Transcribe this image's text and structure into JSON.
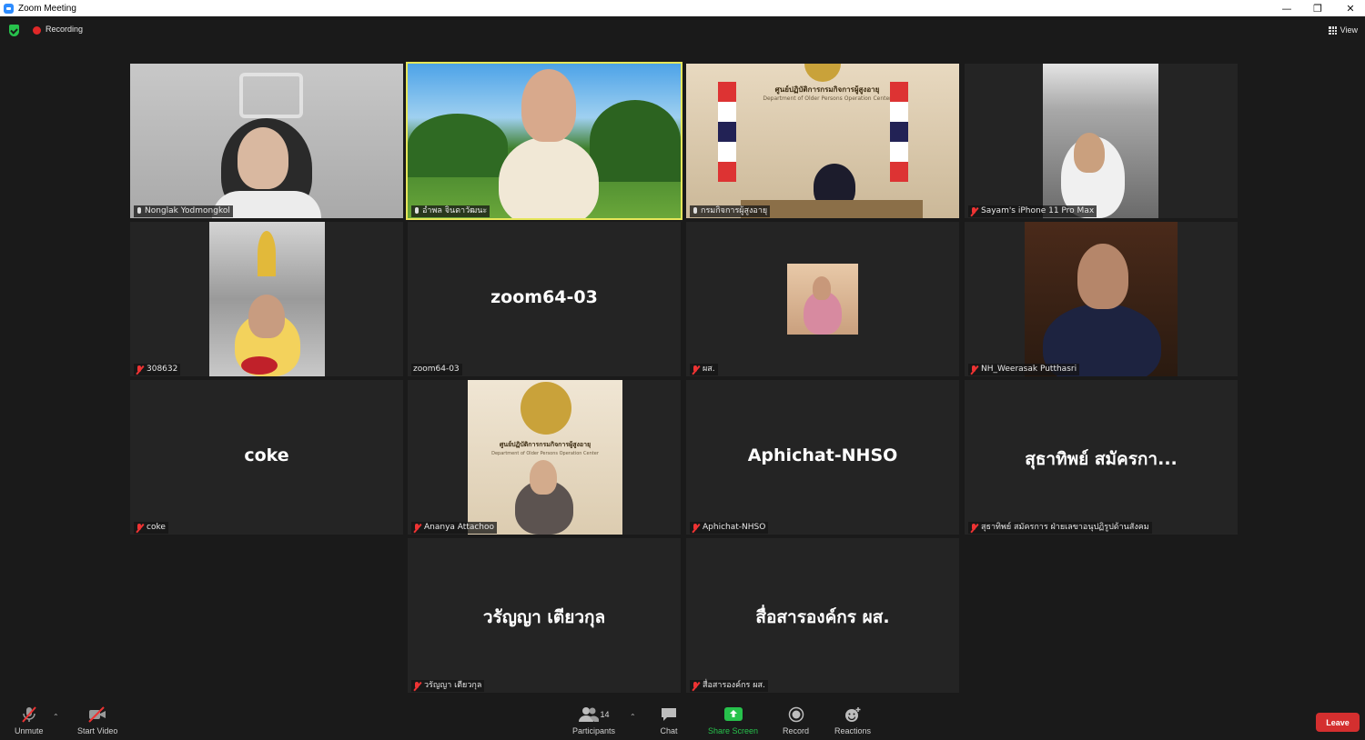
{
  "window": {
    "title": "Zoom Meeting",
    "controls": [
      "minimize",
      "restore",
      "close"
    ]
  },
  "topbar": {
    "recording_label": "Recording",
    "view_label": "View"
  },
  "tiles": [
    {
      "name": "Nonglak Yodmongkol",
      "muted": false,
      "video": true
    },
    {
      "name": "อำพล จินดาวัฒนะ",
      "muted": false,
      "video": true,
      "active_speaker": true
    },
    {
      "name": "กรมกิจการผู้สูงอายุ",
      "muted": false,
      "video": true,
      "sign_text": "ศูนย์ปฏิบัติการกรมกิจการผู้สูงอายุ",
      "sign_subtext": "Department of Older Persons Operation Center"
    },
    {
      "name": "Sayam's iPhone 11 Pro Max",
      "muted": true,
      "video": true
    },
    {
      "name": "308632",
      "muted": true,
      "video": true
    },
    {
      "name": "zoom64-03",
      "muted": false,
      "video": false,
      "display_name": "zoom64-03"
    },
    {
      "name": "ผส.",
      "muted": true,
      "video": true
    },
    {
      "name": "NH_Weerasak Putthasri",
      "muted": true,
      "video": true
    },
    {
      "name": "coke",
      "muted": true,
      "video": false,
      "display_name": "coke"
    },
    {
      "name": "Ananya  Attachoo",
      "muted": true,
      "video": true,
      "sign_text": "ศูนย์ปฏิบัติการกรมกิจการผู้สูงอายุ",
      "sign_subtext": "Department of Older Persons Operation Center"
    },
    {
      "name": "Aphichat-NHSO",
      "muted": true,
      "video": false,
      "display_name": "Aphichat-NHSO"
    },
    {
      "name": "สุธาทิพย์ สมัครการ ฝ่ายเลขาอนุปฏิรูปด้านสังคม",
      "muted": true,
      "video": false,
      "display_name": "สุธาทิพย์ สมัครกา..."
    },
    {
      "name": "วรัญญา เตียวกุล",
      "muted": true,
      "video": false,
      "display_name": "วรัญญา เตียวกุล"
    },
    {
      "name": "สื่อสารองค์กร ผส.",
      "muted": true,
      "video": false,
      "display_name": "สื่อสารองค์กร ผส."
    }
  ],
  "toolbar": {
    "unmute": "Unmute",
    "start_video": "Start Video",
    "participants": "Participants",
    "participants_count": "14",
    "chat": "Chat",
    "share_screen": "Share Screen",
    "record": "Record",
    "reactions": "Reactions",
    "leave": "Leave"
  },
  "colors": {
    "active_outline": "#e6e65a",
    "share_green": "#27c24c",
    "leave_red": "#d42f2f",
    "mute_red": "#e33333"
  }
}
